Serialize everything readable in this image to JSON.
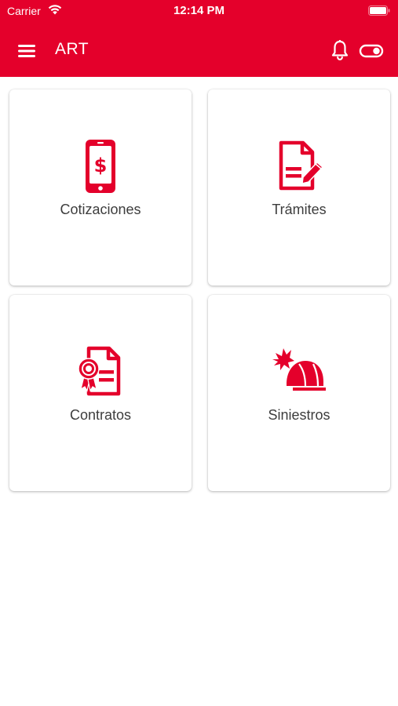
{
  "status_bar": {
    "carrier": "Carrier",
    "time": "12:14 PM"
  },
  "header": {
    "title": "ART",
    "background_color": "#e4002b",
    "menu_icon": "hamburger-menu-icon",
    "notification_icon": "bell-icon",
    "toggle_icon": "toggle-icon"
  },
  "cards": [
    {
      "label": "Cotizaciones",
      "icon": "phone-dollar-icon"
    },
    {
      "label": "Trámites",
      "icon": "document-pencil-icon"
    },
    {
      "label": "Contratos",
      "icon": "certificate-document-icon"
    },
    {
      "label": "Siniestros",
      "icon": "hard-hat-accident-icon"
    }
  ],
  "accent_color": "#e4002b"
}
